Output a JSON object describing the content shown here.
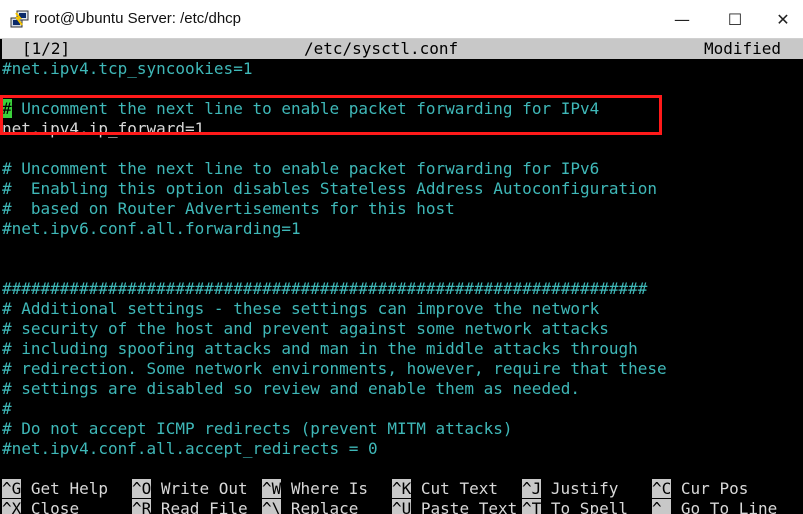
{
  "window": {
    "title": "root@Ubuntu Server: /etc/dhcp",
    "minimize_glyph": "—",
    "maximize_glyph": "☐",
    "close_glyph": "✕"
  },
  "status": {
    "page": "[1/2]",
    "filename": "/etc/sysctl.conf",
    "state": "Modified"
  },
  "lines": [
    "#net.ipv4.tcp_syncookies=1",
    "",
    "# Uncomment the next line to enable packet forwarding for IPv4",
    "net.ipv4.ip_forward=1",
    "",
    "# Uncomment the next line to enable packet forwarding for IPv6",
    "#  Enabling this option disables Stateless Address Autoconfiguration",
    "#  based on Router Advertisements for this host",
    "#net.ipv6.conf.all.forwarding=1",
    "",
    "",
    "###################################################################",
    "# Additional settings - these settings can improve the network",
    "# security of the host and prevent against some network attacks",
    "# including spoofing attacks and man in the middle attacks through",
    "# redirection. Some network environments, however, require that these",
    "# settings are disabled so review and enable them as needed.",
    "#",
    "# Do not accept ICMP redirects (prevent MITM attacks)",
    "#net.ipv4.conf.all.accept_redirects = 0"
  ],
  "highlight_line_rest": " Uncomment the next line to enable packet forwarding for IPv4",
  "cursor_char": "#",
  "shortcuts_row1": [
    {
      "key": "^G",
      "label": "Get Help"
    },
    {
      "key": "^O",
      "label": "Write Out"
    },
    {
      "key": "^W",
      "label": "Where Is"
    },
    {
      "key": "^K",
      "label": "Cut Text"
    },
    {
      "key": "^J",
      "label": "Justify"
    },
    {
      "key": "^C",
      "label": "Cur Pos"
    }
  ],
  "shortcuts_row2": [
    {
      "key": "^X",
      "label": "Close"
    },
    {
      "key": "^R",
      "label": "Read File"
    },
    {
      "key": "^\\",
      "label": "Replace"
    },
    {
      "key": "^U",
      "label": "Paste Text"
    },
    {
      "key": "^T",
      "label": "To Spell"
    },
    {
      "key": "^_",
      "label": "Go To Line"
    }
  ],
  "colors": {
    "comment": "#3fb8b8",
    "text": "#d8d8d8",
    "cursor": "#3bd13b",
    "highlight_box": "#ff1a1a",
    "statusbar_bg": "#c8c8c8"
  }
}
